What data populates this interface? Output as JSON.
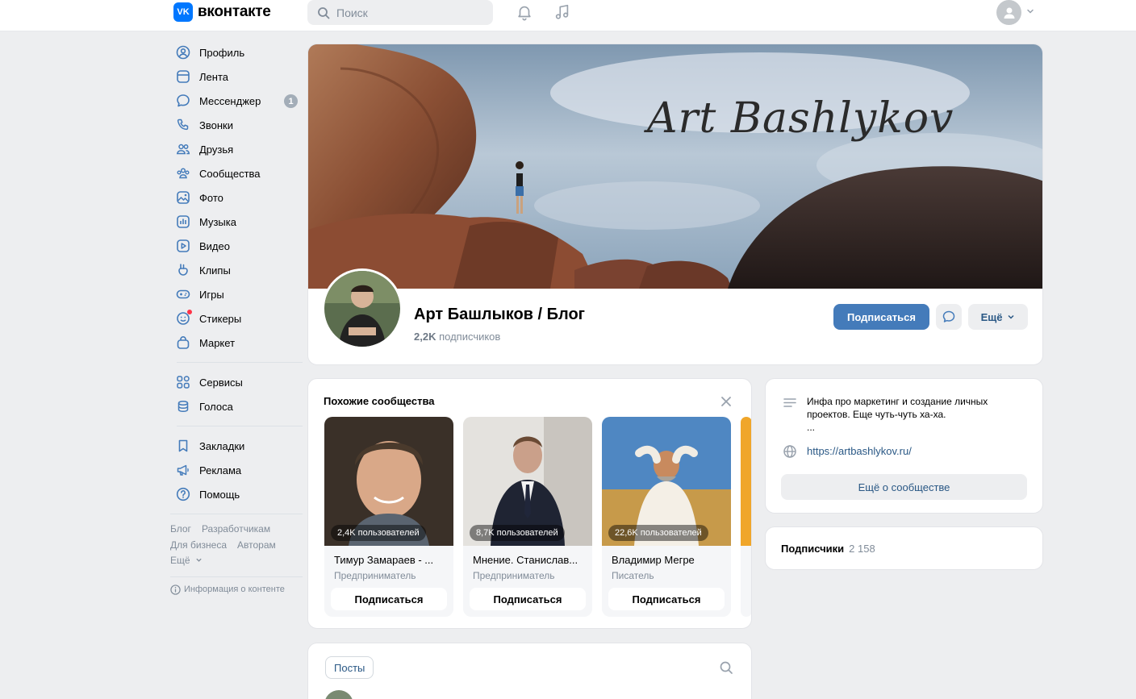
{
  "header": {
    "logo_mark": "VK",
    "logo_text": "вконтакте",
    "search_placeholder": "Поиск"
  },
  "nav": {
    "items": [
      {
        "label": "Профиль"
      },
      {
        "label": "Лента"
      },
      {
        "label": "Мессенджер",
        "badge": "1"
      },
      {
        "label": "Звонки"
      },
      {
        "label": "Друзья"
      },
      {
        "label": "Сообщества"
      },
      {
        "label": "Фото"
      },
      {
        "label": "Музыка"
      },
      {
        "label": "Видео"
      },
      {
        "label": "Клипы"
      },
      {
        "label": "Игры"
      },
      {
        "label": "Стикеры"
      },
      {
        "label": "Маркет"
      }
    ],
    "group2": [
      {
        "label": "Сервисы"
      },
      {
        "label": "Голоса"
      }
    ],
    "group3": [
      {
        "label": "Закладки"
      },
      {
        "label": "Реклама"
      },
      {
        "label": "Помощь"
      }
    ],
    "footer": {
      "blog": "Блог",
      "developers": "Разработчикам",
      "business": "Для бизнеса",
      "authors": "Авторам",
      "more": "Ещё",
      "content_info": "Информация о контенте"
    }
  },
  "profile": {
    "cover_title": "Art Bashlykov",
    "name": "Арт Башлыков / Блог",
    "subs_count": "2,2K",
    "subs_label": "подписчиков",
    "subscribe_label": "Подписаться",
    "more_label": "Ещё"
  },
  "similar": {
    "title": "Похожие сообщества",
    "cards": [
      {
        "count": "2,4K пользователей",
        "name": "Тимур Замараев - ...",
        "role": "Предприниматель",
        "button": "Подписаться"
      },
      {
        "count": "8,7K пользователей",
        "name": "Мнение. Станислав...",
        "role": "Предприниматель",
        "button": "Подписаться"
      },
      {
        "count": "22,6K пользователей",
        "name": "Владимир Мегре",
        "role": "Писатель",
        "button": "Подписаться"
      }
    ]
  },
  "about": {
    "description_line1": "Инфа про маркетинг и создание личных",
    "description_line2": "проектов. Еще чуть-чуть ха-ха.",
    "description_line3": "...",
    "link": "https://artbashlykov.ru/",
    "more_button": "Ещё о сообществе"
  },
  "followers": {
    "title": "Подписчики",
    "count": "2 158"
  },
  "posts": {
    "tab": "Посты"
  },
  "colors": {
    "accent": "#447bba",
    "link": "#2a5885",
    "bg": "#edeef0",
    "logo": "#0077ff"
  }
}
